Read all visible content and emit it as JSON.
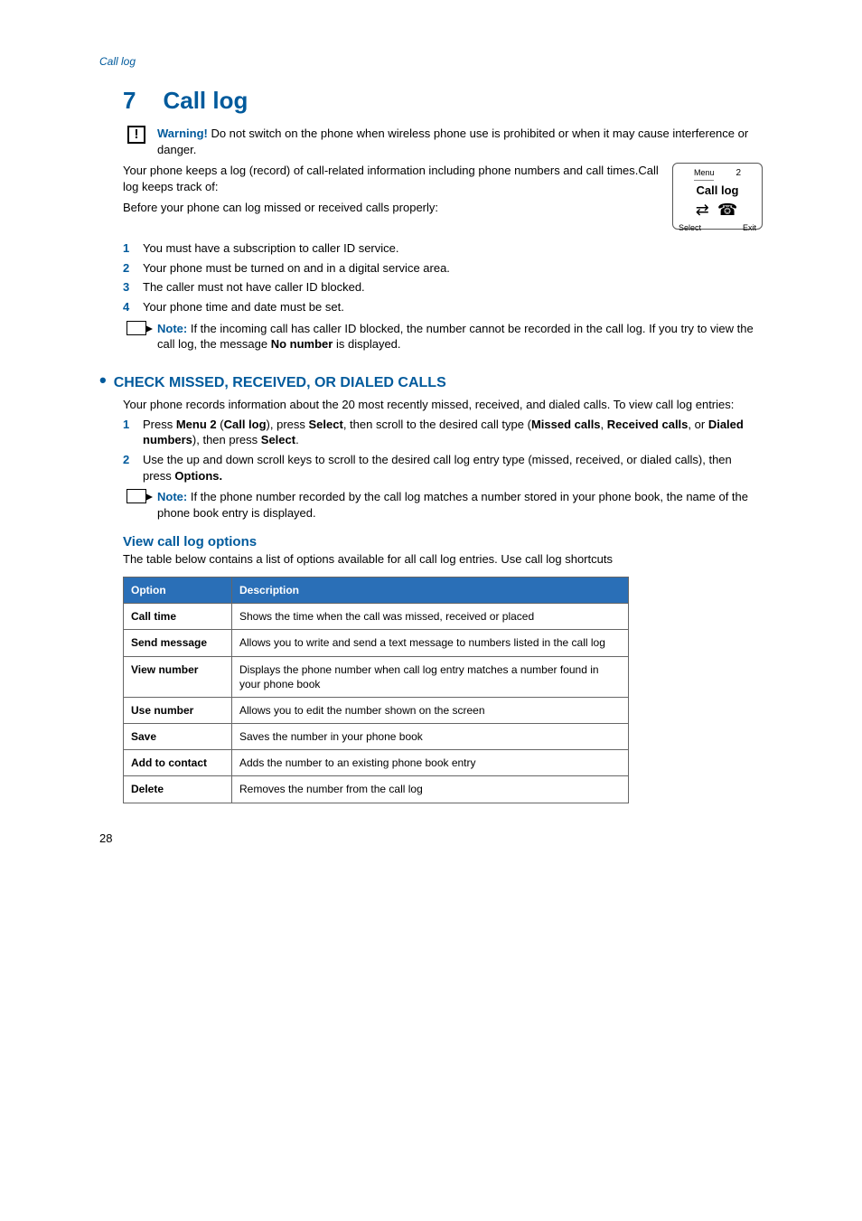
{
  "breadcrumb": "Call log",
  "chapter": {
    "num": "7",
    "title": "Call log"
  },
  "warning": {
    "label": "Warning!",
    "text": " Do not switch on the phone when wireless phone use is prohibited or when it may cause interference or danger."
  },
  "intro_p1": "Your phone keeps a log (record) of call-related information including phone numbers and call times.Call log keeps track of:",
  "intro_p2": "Before your phone can log missed or received calls properly:",
  "phone_screen": {
    "menu": "Menu",
    "index": "2",
    "title": "Call log",
    "select": "Select",
    "exit": "Exit"
  },
  "reqs": [
    "You must have a subscription to caller ID service.",
    "Your phone must be turned on and in a digital service area.",
    "The caller must not have caller ID blocked.",
    "Your phone time and date must be set."
  ],
  "note1": {
    "label": "Note:",
    "text_a": " If the incoming call has caller ID blocked, the number cannot be recorded in the call log. If you try to view the call log, the message ",
    "bold": "No number",
    "text_b": " is displayed."
  },
  "section1": {
    "title": "CHECK MISSED, RECEIVED, OR DIALED CALLS",
    "intro": "Your phone records information about the 20 most recently missed, received, and dialed calls. To view call log entries:",
    "steps": [
      {
        "a": "Press ",
        "b1": "Menu 2",
        "c": " (",
        "b2": "Call log",
        "d": "), press ",
        "b3": "Select",
        "e": ", then scroll to the desired call type (",
        "b4": "Missed calls",
        "f": ", ",
        "b5": "Received calls",
        "g": ", or ",
        "b6": "Dialed numbers",
        "h": "), then press ",
        "b7": "Select",
        "i": "."
      },
      {
        "a": "Use the up and down scroll keys to scroll to the desired call log entry type (missed, received, or dialed calls), then press ",
        "b1": "Options."
      }
    ]
  },
  "note2": {
    "label": "Note:",
    "text": " If the phone number recorded by the call log matches a number stored in your phone book, the name of the phone book entry is displayed."
  },
  "section2": {
    "title": "View call log options",
    "intro": "The table below contains a list of options available for all call log entries. Use call log shortcuts"
  },
  "table": {
    "headers": {
      "option": "Option",
      "desc": "Description"
    },
    "rows": [
      {
        "opt": "Call time",
        "desc": "Shows the time when the call was missed, received or placed"
      },
      {
        "opt": "Send message",
        "desc": "Allows you to write and send a text message to numbers listed in the call log"
      },
      {
        "opt": "View number",
        "desc": "Displays the phone number when call log entry matches a number found in your phone book"
      },
      {
        "opt": "Use number",
        "desc": "Allows you to edit the number shown on the screen"
      },
      {
        "opt": "Save",
        "desc": "Saves the number in your phone book"
      },
      {
        "opt": "Add to contact",
        "desc": "Adds the number to an existing phone book entry"
      },
      {
        "opt": "Delete",
        "desc": "Removes the number from the call log"
      }
    ]
  },
  "page_num": "28"
}
